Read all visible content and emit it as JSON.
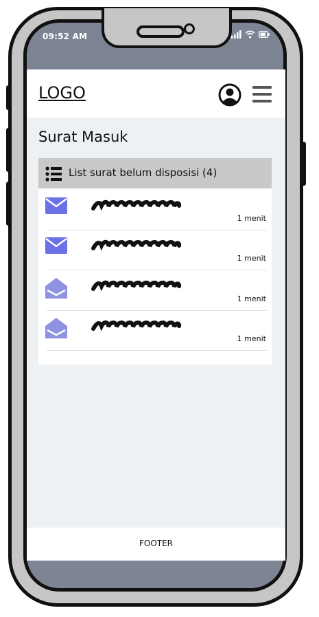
{
  "status_bar": {
    "time": "09:52 AM"
  },
  "header": {
    "logo": "LOGO"
  },
  "page": {
    "title": "Surat Masuk"
  },
  "card": {
    "title": "List surat belum disposisi (4)"
  },
  "mails": [
    {
      "time": "1 menit",
      "status": "unread"
    },
    {
      "time": "1 menit",
      "status": "unread"
    },
    {
      "time": "1 menit",
      "status": "read"
    },
    {
      "time": "1 menit",
      "status": "read"
    }
  ],
  "footer": {
    "label": "FOOTER"
  },
  "colors": {
    "accent": "#6b72e6",
    "read_icon": "#8e92e0",
    "app_bg": "#edf1f4",
    "card_header": "#c8c8c8"
  }
}
